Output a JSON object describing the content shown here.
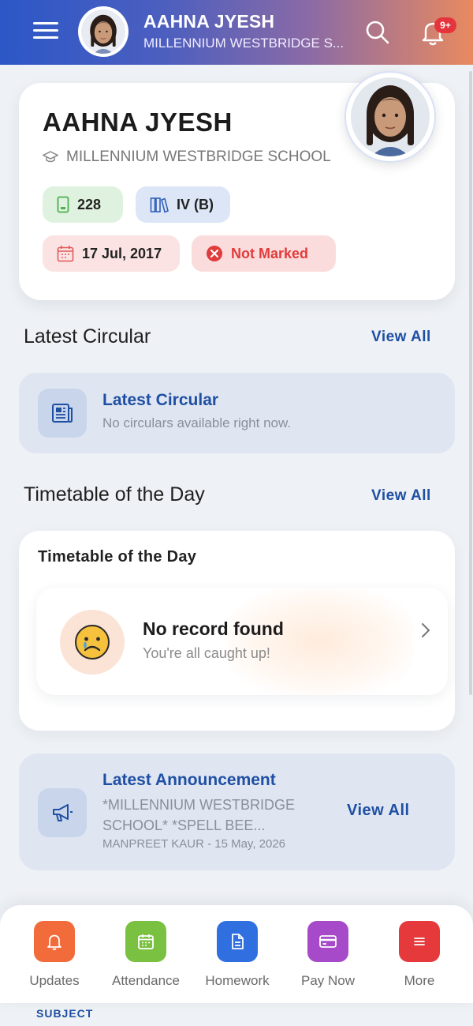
{
  "header": {
    "student_name": "AAHNA JYESH",
    "school_short": "MILLENNIUM WESTBRIDGE S...",
    "notification_badge": "9+",
    "icons": [
      "menu-icon",
      "search-icon",
      "bell-icon"
    ]
  },
  "profile": {
    "name": "AAHNA JYESH",
    "school": "MILLENNIUM WESTBRIDGE SCHOOL",
    "roll_number": "228",
    "class_section": "IV (B)",
    "date": "17 Jul, 2017",
    "attendance_status": "Not Marked"
  },
  "circular_section": {
    "title": "Latest Circular",
    "view_all": "View All",
    "card_title": "Latest Circular",
    "card_message": "No circulars available right now."
  },
  "timetable_section": {
    "title": "Timetable of the Day",
    "view_all": "View All",
    "card_title": "Timetable of the Day",
    "empty_title": "No record found",
    "empty_subtitle": "You're all caught up!"
  },
  "announcement": {
    "title": "Latest Announcement",
    "text": "*MILLENNIUM WESTBRIDGE SCHOOL* *SPELL BEE...",
    "meta": "MANPREET KAUR - 15 May, 2026",
    "view_all": "View All"
  },
  "bottom_nav": {
    "items": [
      {
        "label": "Updates",
        "icon": "bell-icon",
        "color": "#f26b3a"
      },
      {
        "label": "Attendance",
        "icon": "calendar-icon",
        "color": "#7ac142"
      },
      {
        "label": "Homework",
        "icon": "document-icon",
        "color": "#2f6fe0"
      },
      {
        "label": "Pay Now",
        "icon": "card-icon",
        "color": "#a64ac9"
      },
      {
        "label": "More",
        "icon": "menu-icon",
        "color": "#e5393b"
      }
    ],
    "peek_label": "SUBJECT"
  },
  "colors": {
    "accent_blue": "#1f4fa3",
    "status_red": "#e13b3b",
    "header_gradient_start": "#2c57c7",
    "header_gradient_end": "#e88a5f"
  }
}
